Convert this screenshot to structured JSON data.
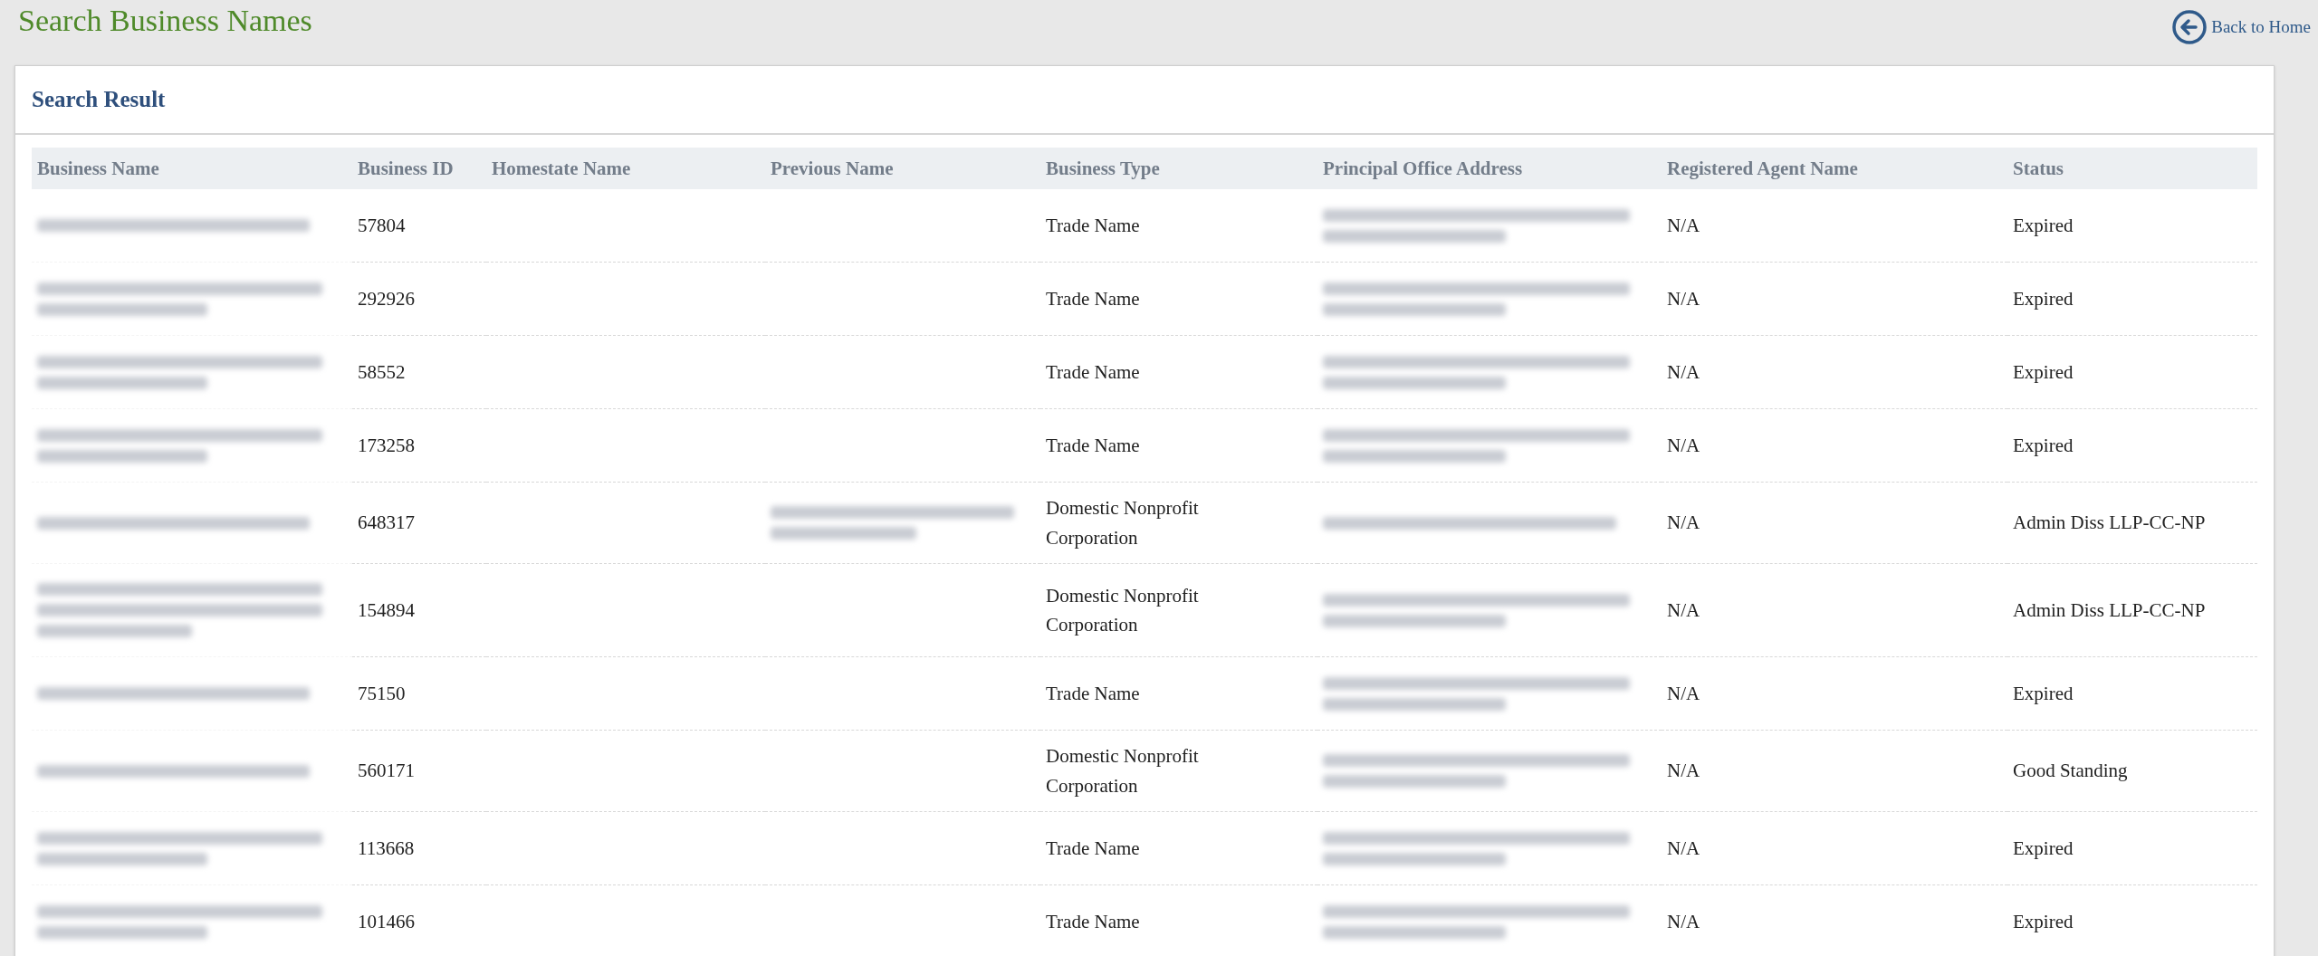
{
  "page_title": "Search Business Names",
  "back_link": {
    "label": "Back to Home"
  },
  "panel": {
    "title": "Search Result"
  },
  "table": {
    "columns": [
      "Business Name",
      "Business ID",
      "Homestate Name",
      "Previous Name",
      "Business Type",
      "Principal Office Address",
      "Registered Agent Name",
      "Status"
    ],
    "rows": [
      {
        "business_name": {
          "kind": "blur1"
        },
        "business_id": "57804",
        "business_type": "Trade Name",
        "address": {
          "kind": "blur2"
        },
        "agent": "N/A",
        "status": "Expired"
      },
      {
        "business_name": {
          "kind": "blur2"
        },
        "business_id": "292926",
        "business_type": "Trade Name",
        "address": {
          "kind": "blur2"
        },
        "agent": "N/A",
        "status": "Expired"
      },
      {
        "business_name": {
          "kind": "blur2"
        },
        "business_id": "58552",
        "business_type": "Trade Name",
        "address": {
          "kind": "blur2"
        },
        "agent": "N/A",
        "status": "Expired"
      },
      {
        "business_name": {
          "kind": "blur2"
        },
        "business_id": "173258",
        "business_type": "Trade Name",
        "address": {
          "kind": "blur2"
        },
        "agent": "N/A",
        "status": "Expired"
      },
      {
        "business_name": {
          "kind": "blur1"
        },
        "business_id": "648317",
        "previous_name": {
          "kind": "blur2"
        },
        "business_type": "Domestic Nonprofit Corporation",
        "address": {
          "kind": "blur1"
        },
        "agent": "N/A",
        "status": "Admin Diss LLP-CC-NP"
      },
      {
        "business_name": {
          "kind": "blur3"
        },
        "business_id": "154894",
        "business_type": "Domestic Nonprofit Corporation",
        "address": {
          "kind": "blur2"
        },
        "agent": "N/A",
        "status": "Admin Diss LLP-CC-NP"
      },
      {
        "business_name": {
          "kind": "blur1"
        },
        "business_id": "75150",
        "business_type": "Trade Name",
        "address": {
          "kind": "blur2"
        },
        "agent": "N/A",
        "status": "Expired"
      },
      {
        "business_name": {
          "kind": "blur1"
        },
        "business_id": "560171",
        "business_type": "Domestic Nonprofit Corporation",
        "address": {
          "kind": "blur2"
        },
        "agent": "N/A",
        "status": "Good Standing"
      },
      {
        "business_name": {
          "kind": "blur2"
        },
        "business_id": "113668",
        "business_type": "Trade Name",
        "address": {
          "kind": "blur2"
        },
        "agent": "N/A",
        "status": "Expired"
      },
      {
        "business_name": {
          "kind": "blur2"
        },
        "business_id": "101466",
        "business_type": "Trade Name",
        "address": {
          "kind": "blur2"
        },
        "agent": "N/A",
        "status": "Expired"
      }
    ]
  }
}
